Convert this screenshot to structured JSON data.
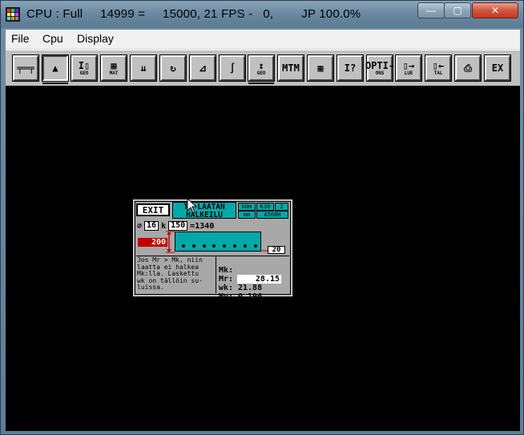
{
  "window": {
    "title": "CPU : Full     14999 =     15000, 21 FPS -   0,        JP 100.0%",
    "controls": {
      "minimize": "—",
      "maximize": "▢",
      "close": "✕"
    }
  },
  "menu": [
    "File",
    "Cpu",
    "Display"
  ],
  "toolbar": [
    {
      "name": "beam-tool",
      "glyph": "╤═╤",
      "text": ""
    },
    {
      "name": "support-tool",
      "glyph": "▲",
      "text": ""
    },
    {
      "name": "geo-section-tool",
      "glyph": "I▯",
      "text": "GEO"
    },
    {
      "name": "material-tool",
      "glyph": "▦",
      "text": "MAT"
    },
    {
      "name": "loads-tool",
      "glyph": "⇊",
      "text": ""
    },
    {
      "name": "moment-tool",
      "glyph": "↻",
      "text": ""
    },
    {
      "name": "diagram-tool",
      "glyph": "⊿",
      "text": ""
    },
    {
      "name": "integral-tool",
      "glyph": "∫",
      "text": ""
    },
    {
      "name": "geo-height-tool",
      "glyph": "↕",
      "text": "GEO"
    },
    {
      "name": "mtm-tool",
      "glyph": "MTM",
      "text": ""
    },
    {
      "name": "calculator-tool",
      "glyph": "▦",
      "text": ""
    },
    {
      "name": "info-tool",
      "glyph": "I?",
      "text": ""
    },
    {
      "name": "options-tool",
      "glyph": "OPTI-",
      "text": "ONS"
    },
    {
      "name": "read-tool",
      "glyph": "▯→",
      "text": "LUE"
    },
    {
      "name": "save-tool",
      "glyph": "▯←",
      "text": "TAL"
    },
    {
      "name": "print-tool",
      "glyph": "⎙",
      "text": ""
    },
    {
      "name": "exit-tool",
      "glyph": "EX",
      "text": ""
    }
  ],
  "panel": {
    "exit_label": "EXIT",
    "header_line1": "TB LAATAN",
    "header_line2": "HALKEILU",
    "units": {
      "force": "kNm",
      "length": "mm",
      "concrete": "K30",
      "count": "2",
      "steel": "A500H"
    },
    "bar_diameter": "16",
    "spacing_prefix": "k",
    "spacing": "150",
    "spacing_result": "=1340",
    "diameter_symbol": "⌀",
    "height": "200",
    "cover": "20",
    "note": "Jos Mr > Mk, niin\nlaatta ei halkea\nMk:lla. Laskettu\nwk on tällöin su-\nluissa.",
    "results": [
      {
        "label": "Mk:",
        "value": "28.15"
      },
      {
        "label": "Mr:",
        "value": "21.88"
      },
      {
        "label": "wk:",
        "value": "0.106"
      },
      {
        "label": "Mu:",
        "value": "84.92"
      }
    ]
  },
  "colors": {
    "teal": "#00a8a8",
    "red": "#c00000",
    "panel": "#a8a8a8"
  }
}
